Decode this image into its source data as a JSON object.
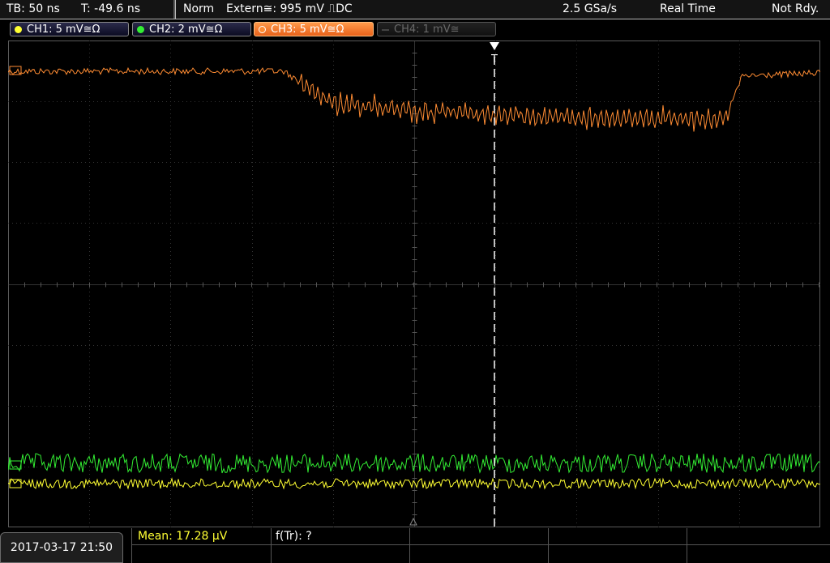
{
  "header": {
    "timebase": "TB: 50 ns",
    "trigger_time": "T: -49.6 ns",
    "mode": "Norm",
    "trigger_source": "Extern≅: 995 mV ⎍DC",
    "sample_rate": "2.5 GSa/s",
    "acquisition": "Real Time",
    "status": "Not Rdy."
  },
  "channels": [
    {
      "label": "CH1: 5 mV≅Ω",
      "color": "#ffff33",
      "state": "on"
    },
    {
      "label": "CH2: 2 mV≅Ω",
      "color": "#33ee33",
      "state": "on"
    },
    {
      "label": "CH3: 5 mV≅Ω",
      "color": "#ff8c33",
      "state": "active"
    },
    {
      "label": "CH4: 1 mV≅",
      "color": "#666666",
      "state": "off"
    }
  ],
  "trigger_marker": "T",
  "footer": {
    "datetime": "2017-03-17 21:50",
    "measurement": "Mean: 17.28 µV",
    "measurement_color": "#ffff33",
    "function": "f(Tr): ?"
  }
}
